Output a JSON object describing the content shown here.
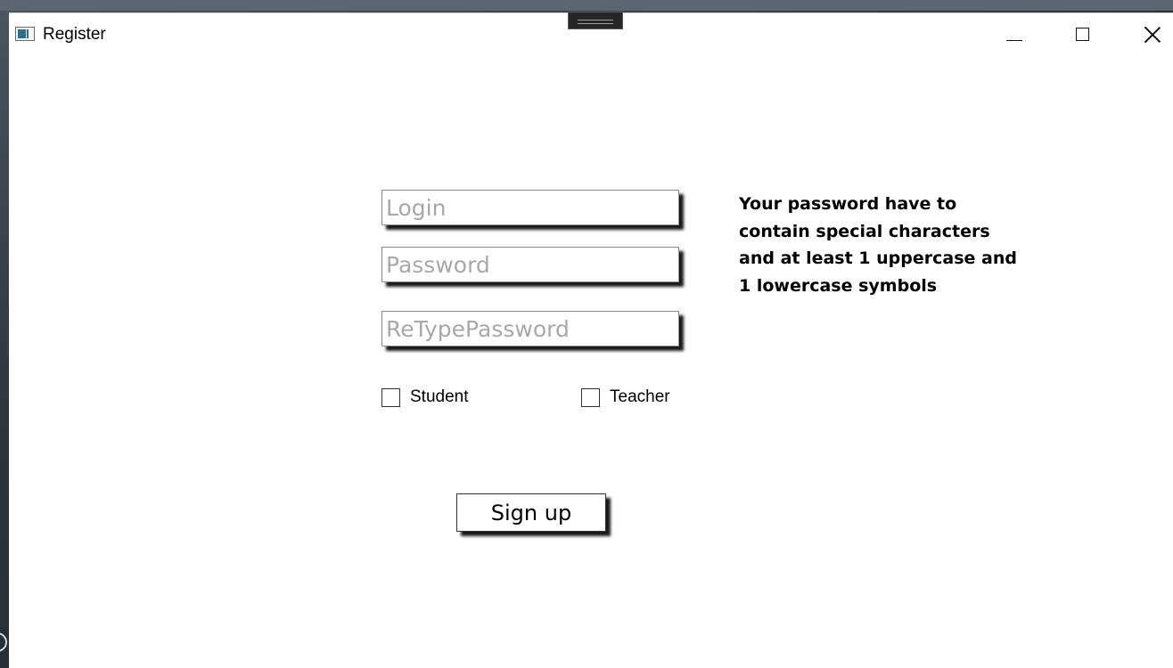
{
  "window": {
    "title": "Register"
  },
  "form": {
    "login": {
      "placeholder": "Login",
      "value": ""
    },
    "password": {
      "placeholder": "Password",
      "value": ""
    },
    "retype_password": {
      "placeholder": "ReTypePassword",
      "value": ""
    },
    "roles": [
      {
        "label": "Student",
        "checked": false
      },
      {
        "label": "Teacher",
        "checked": false
      }
    ],
    "submit_label": "Sign up"
  },
  "hint": {
    "text": "Your password have to contain special characters and at least 1 uppercase and 1 lowercase symbols"
  },
  "icons": {
    "app": "app-window-icon",
    "minimize": "minimize-icon",
    "maximize": "maximize-icon",
    "close": "close-icon"
  }
}
